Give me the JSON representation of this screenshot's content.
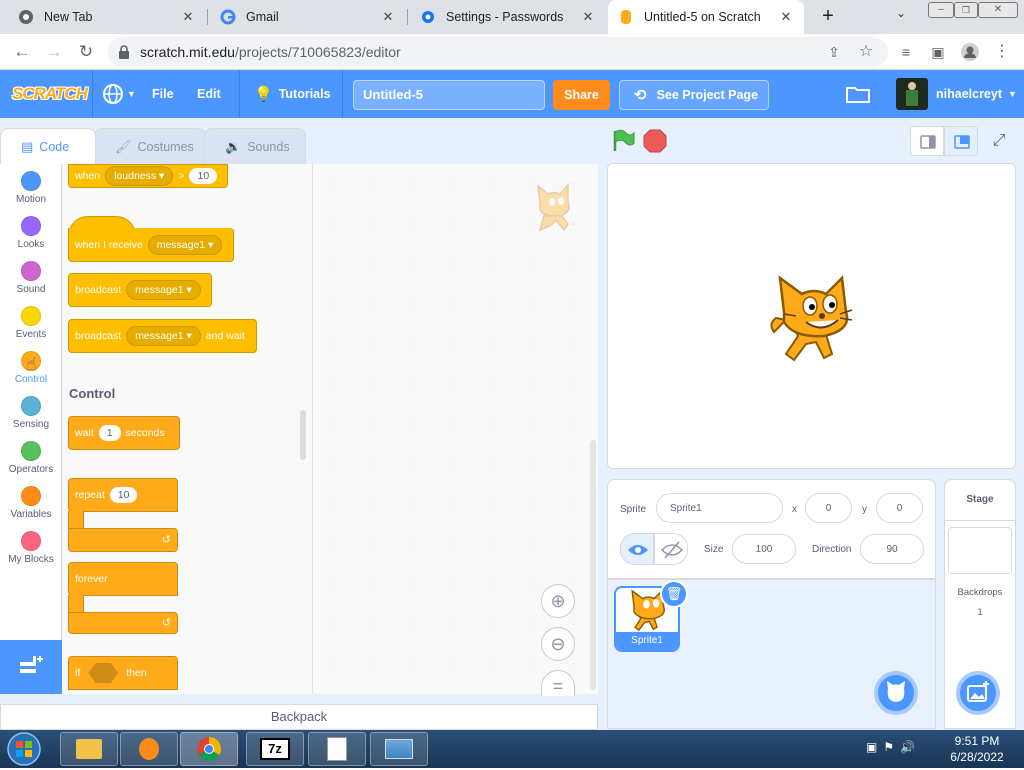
{
  "browser": {
    "tabs": [
      {
        "title": "New Tab",
        "icon": "chrome-icon"
      },
      {
        "title": "Gmail",
        "icon": "google-icon"
      },
      {
        "title": "Settings - Passwords",
        "icon": "gear-icon"
      },
      {
        "title": "Untitled-5 on Scratch",
        "icon": "scratch-icon"
      }
    ],
    "url_host": "scratch.mit.edu",
    "url_path": "/projects/710065823/editor"
  },
  "menubar": {
    "logo": "SCRATCH",
    "file": "File",
    "edit": "Edit",
    "tutorials": "Tutorials",
    "project_title": "Untitled-5",
    "share": "Share",
    "see_project": "See Project Page",
    "username": "nihaelcreyt"
  },
  "editor_tabs": {
    "code": "Code",
    "costumes": "Costumes",
    "sounds": "Sounds"
  },
  "categories": [
    {
      "label": "Motion",
      "color": "#4c97ff"
    },
    {
      "label": "Looks",
      "color": "#9966ff"
    },
    {
      "label": "Sound",
      "color": "#cf63cf"
    },
    {
      "label": "Events",
      "color": "#ffd500"
    },
    {
      "label": "Control",
      "color": "#ffab19"
    },
    {
      "label": "Sensing",
      "color": "#5cb1d6"
    },
    {
      "label": "Operators",
      "color": "#59c059"
    },
    {
      "label": "Variables",
      "color": "#ff8c1a"
    },
    {
      "label": "My Blocks",
      "color": "#ff6680"
    }
  ],
  "blocks": {
    "when": "when",
    "loudness": "loudness",
    "gt": ">",
    "loud_val": "10",
    "when_receive": "when I receive",
    "message1": "message1",
    "broadcast": "broadcast",
    "and_wait": "and wait",
    "control_heading": "Control",
    "wait": "wait",
    "wait_val": "1",
    "seconds": "seconds",
    "repeat": "repeat",
    "repeat_val": "10",
    "forever": "forever",
    "if": "if",
    "then": "then"
  },
  "backpack": "Backpack",
  "sprite_info": {
    "sprite_label": "Sprite",
    "sprite_name": "Sprite1",
    "x_label": "x",
    "x_val": "0",
    "y_label": "y",
    "y_val": "0",
    "size_label": "Size",
    "size_val": "100",
    "direction_label": "Direction",
    "direction_val": "90"
  },
  "sprite_list": [
    {
      "name": "Sprite1"
    }
  ],
  "stage_pane": {
    "title": "Stage",
    "backdrops_label": "Backdrops",
    "backdrops_count": "1"
  },
  "taskbar": {
    "time": "9:51 PM",
    "date": "6/28/2022"
  }
}
